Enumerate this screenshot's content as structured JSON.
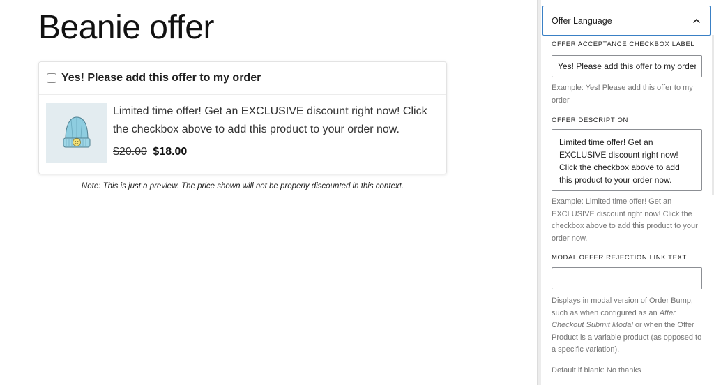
{
  "preview": {
    "title": "Beanie offer",
    "offer": {
      "checkbox_label": "Yes! Please add this offer to my order",
      "product_image": "beanie-product-image",
      "description": "Limited time offer! Get an EXCLUSIVE discount right now! Click the checkbox above to add this product to your order now.",
      "price_old": "$20.00",
      "price_new": "$18.00"
    },
    "note": "Note: This is just a preview. The price shown will not be properly discounted in this context."
  },
  "sidebar": {
    "panel_title": "Offer Language",
    "panel_icon": "chevron-up-icon",
    "fields": {
      "checkbox_label": {
        "label": "OFFER ACCEPTANCE CHECKBOX LABEL",
        "value": "Yes! Please add this offer to my order",
        "help": "Example: Yes! Please add this offer to my order"
      },
      "description": {
        "label": "OFFER DESCRIPTION",
        "value": "Limited time offer! Get an EXCLUSIVE discount right now! Click the checkbox above to add this product to your order now.",
        "help": "Example: Limited time offer! Get an EXCLUSIVE discount right now! Click the checkbox above to add this product to your order now."
      },
      "rejection_link": {
        "label": "MODAL OFFER REJECTION LINK TEXT",
        "value": "",
        "help_before": "Displays in modal version of Order Bump, such as when configured as an",
        "help_em": "After Checkout Submit Modal",
        "help_after": "or when the Offer Product is a variable product (as opposed to a specific variation).",
        "default_note": "Default if blank: No thanks"
      }
    }
  },
  "colors": {
    "panel_border": "#3a80c5",
    "help_text": "#757575",
    "image_bg": "#e3ecf0"
  }
}
